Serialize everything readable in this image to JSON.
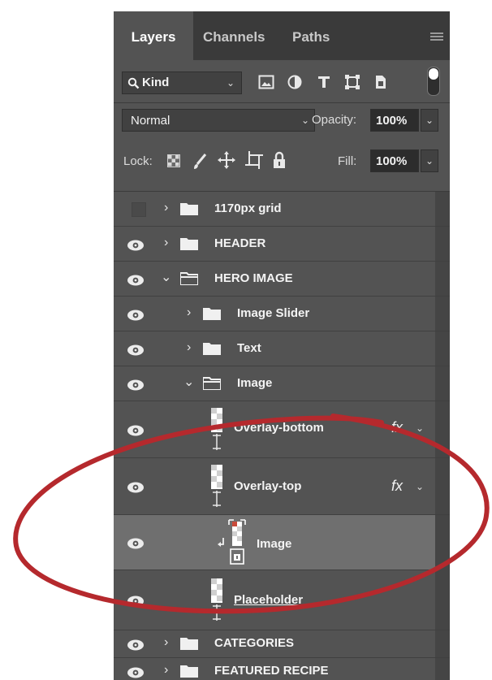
{
  "tabs": [
    {
      "label": "Layers",
      "active": true
    },
    {
      "label": "Channels",
      "active": false
    },
    {
      "label": "Paths",
      "active": false
    }
  ],
  "filter": {
    "kind_label": "Kind"
  },
  "blend": {
    "mode": "Normal",
    "opacity_label": "Opacity:",
    "opacity_value": "100%"
  },
  "lock": {
    "label": "Lock:",
    "fill_label": "Fill:",
    "fill_value": "100%"
  },
  "layers": [
    {
      "name": "1170px grid",
      "type": "group",
      "visible": false,
      "expanded": false,
      "indent": 0
    },
    {
      "name": "HEADER",
      "type": "group",
      "visible": true,
      "expanded": false,
      "indent": 0
    },
    {
      "name": "HERO IMAGE",
      "type": "group",
      "visible": true,
      "expanded": true,
      "indent": 0
    },
    {
      "name": "Image Slider",
      "type": "group",
      "visible": true,
      "expanded": false,
      "indent": 1
    },
    {
      "name": "Text",
      "type": "group",
      "visible": true,
      "expanded": false,
      "indent": 1
    },
    {
      "name": "Image",
      "type": "group",
      "visible": true,
      "expanded": true,
      "indent": 1
    },
    {
      "name": "Overlay-bottom",
      "type": "layer",
      "visible": true,
      "fx": true,
      "indent": 2
    },
    {
      "name": "Overlay-top",
      "type": "layer",
      "visible": true,
      "fx": true,
      "indent": 2
    },
    {
      "name": "Image",
      "type": "smart-object",
      "visible": true,
      "clipped": true,
      "selected": true,
      "indent": 3
    },
    {
      "name": "Placeholder",
      "type": "layer",
      "visible": true,
      "indent": 2
    },
    {
      "name": "CATEGORIES",
      "type": "group",
      "visible": true,
      "expanded": false,
      "indent": 0
    },
    {
      "name": "FEATURED RECIPE",
      "type": "group",
      "visible": true,
      "expanded": false,
      "indent": 0
    }
  ],
  "fx_label": "fx",
  "colors": {
    "panel": "#535353",
    "tab_bar": "#3a3a3a",
    "selected_row": "#6f6f6f",
    "annotation": "#b5292d"
  }
}
